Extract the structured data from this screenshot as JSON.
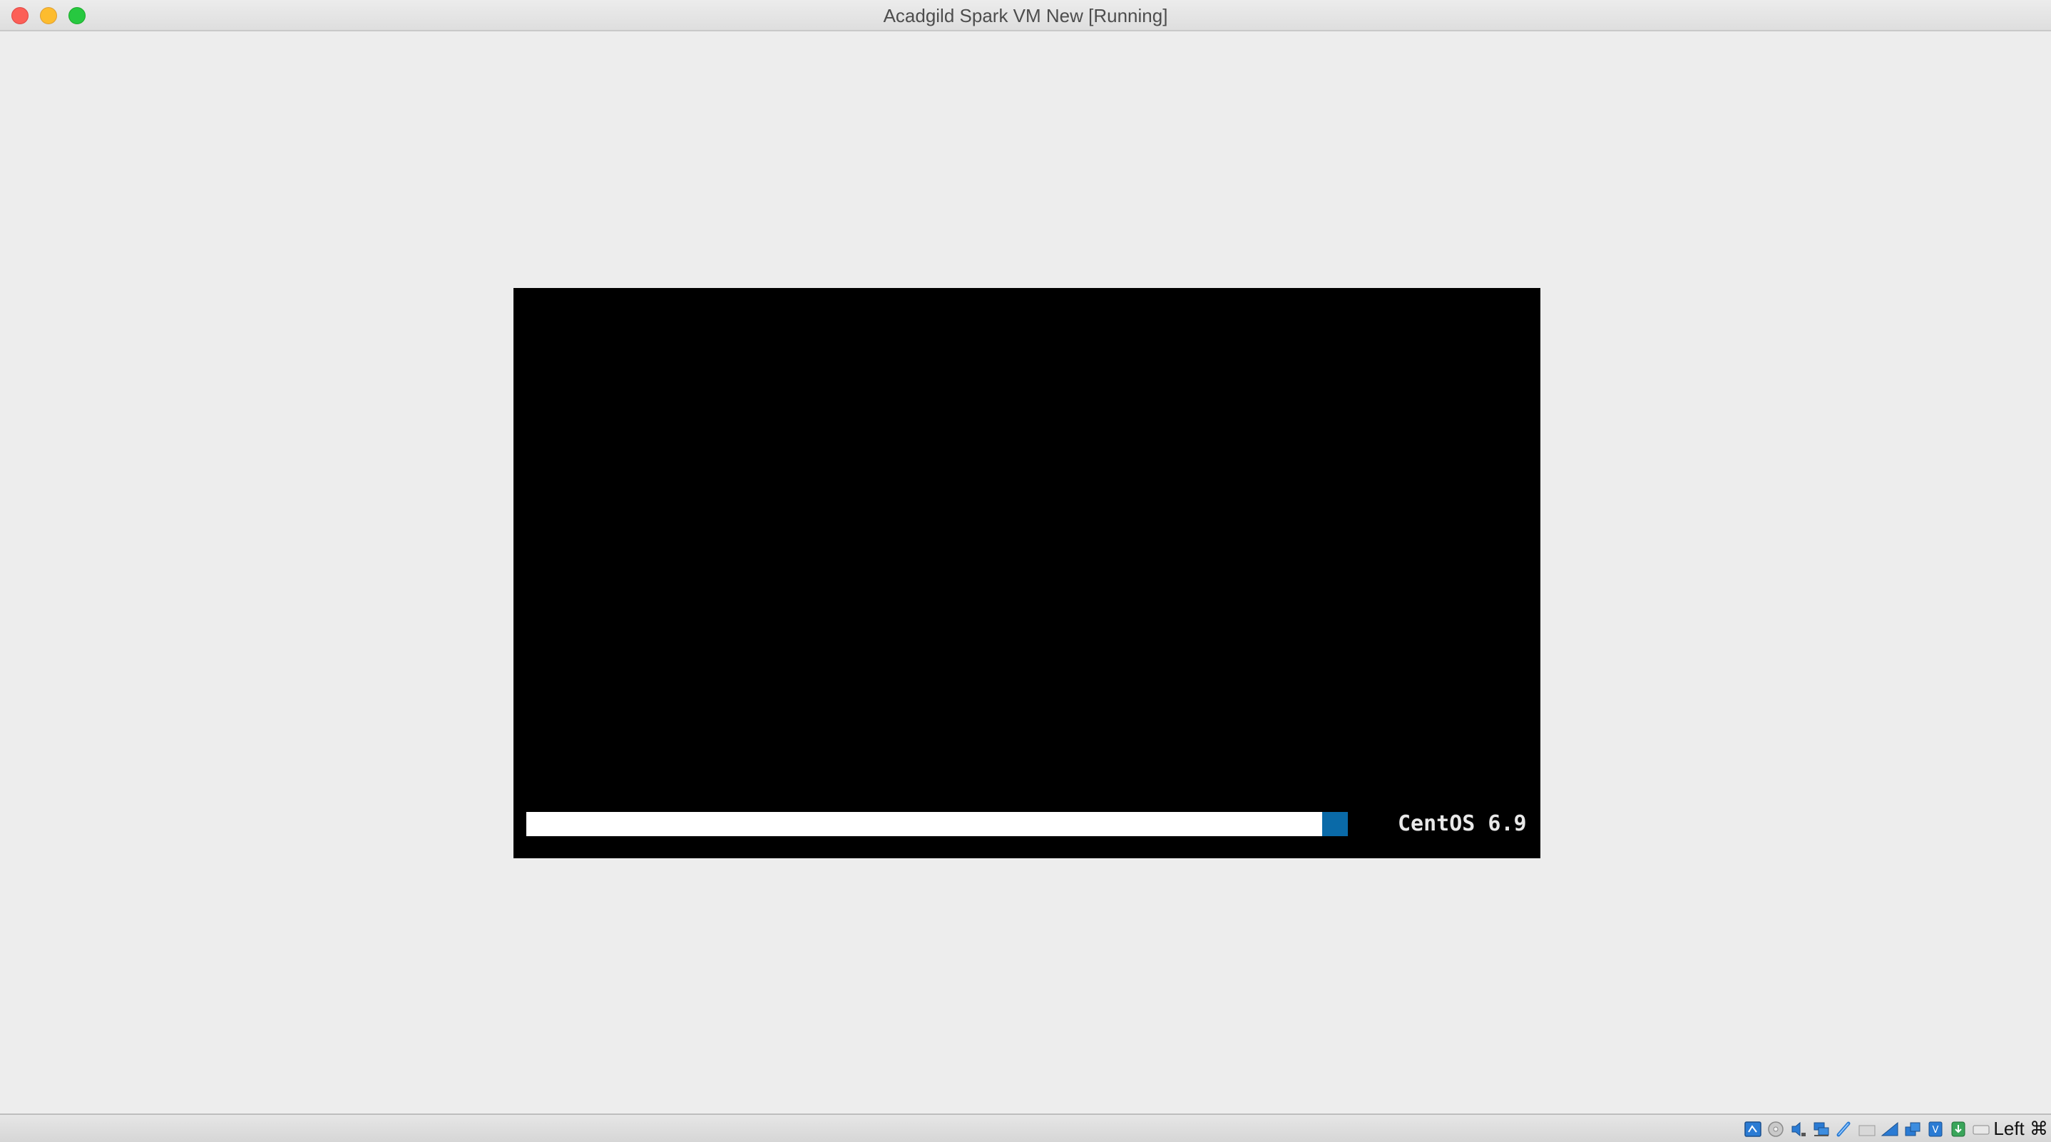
{
  "window": {
    "title": "Acadgild Spark VM New [Running]"
  },
  "vm_display": {
    "os_label": "CentOS 6.9",
    "boot_progress_fraction": 0.97,
    "progress_fill_color": "#ffffff",
    "progress_tip_color": "#0a6aa8"
  },
  "statusbar": {
    "icons": [
      "hard-disk-icon",
      "optical-drive-icon",
      "audio-icon",
      "network-icon",
      "usb-icon",
      "shared-folders-icon",
      "display-icon",
      "video-capture-icon",
      "cpu-icon",
      "mouse-integration-icon",
      "keyboard-icon"
    ],
    "host_key_label": "Left ⌘"
  },
  "colors": {
    "close": "#fc5f57",
    "minimize": "#fdbc2e",
    "maximize": "#27c840",
    "background": "#ededed",
    "vm_screen": "#000000"
  }
}
